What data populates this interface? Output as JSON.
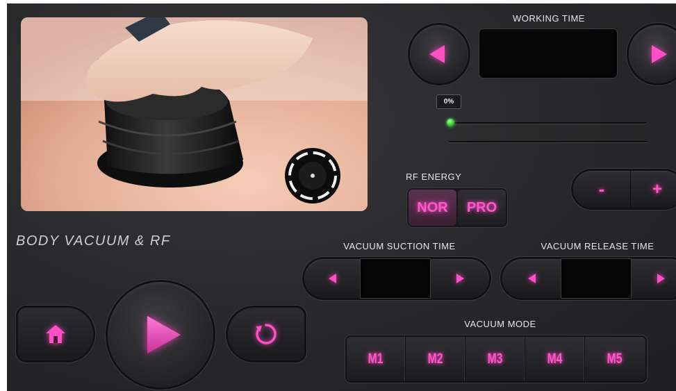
{
  "app_title": "BODY VACUUM & RF",
  "working_time": {
    "label": "WORKING TIME",
    "display_value": "",
    "prev_icon": "triangle-left-icon",
    "next_icon": "triangle-right-icon"
  },
  "progress": {
    "label": "0%",
    "value": 0
  },
  "rf_energy": {
    "label": "RF ENERGY",
    "options": [
      "NOR",
      "PRO"
    ],
    "selected": "NOR"
  },
  "level": {
    "minus_label": "-",
    "plus_label": "+"
  },
  "vacuum_suction_time": {
    "label": "VACUUM SUCTION TIME",
    "display_value": ""
  },
  "vacuum_release_time": {
    "label": "VACUUM RELEASE TIME",
    "display_value": ""
  },
  "vacuum_mode": {
    "label": "VACUUM MODE",
    "modes": [
      "M1",
      "M2",
      "M3",
      "M4",
      "M5"
    ]
  },
  "controls": {
    "home_icon": "home-icon",
    "play_icon": "play-icon",
    "reset_icon": "refresh-icon"
  },
  "colors": {
    "accent": "#ff4fc4",
    "panel": "#2a2a2d",
    "indicator": "#3bd13b"
  }
}
